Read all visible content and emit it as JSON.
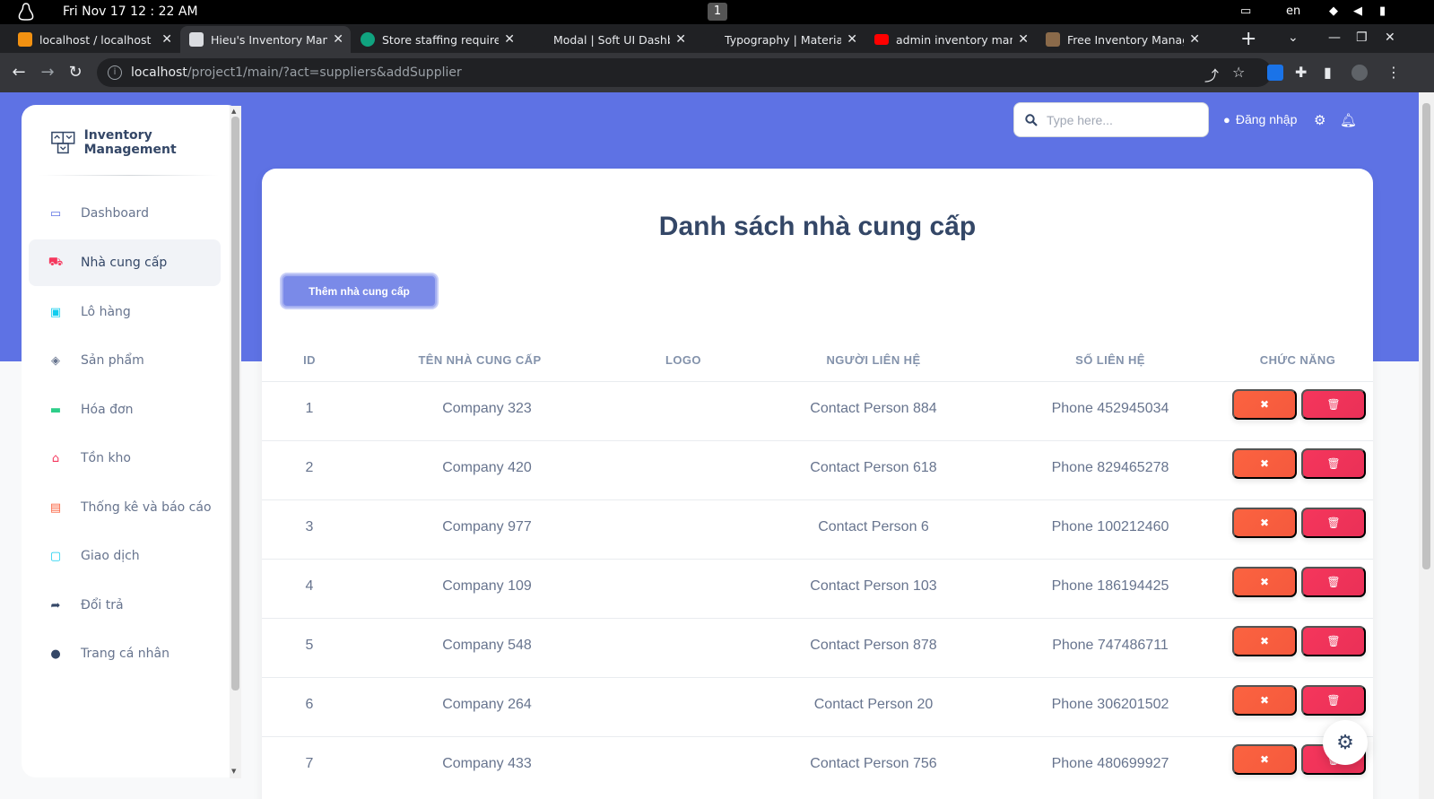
{
  "os": {
    "clock": "Fri Nov 17 12 : 22 AM",
    "workspace": "1",
    "lang": "en"
  },
  "browser": {
    "tabs": [
      {
        "title": "localhost / localhost",
        "fav_color": "#f29111",
        "active": false
      },
      {
        "title": "Hieu's Inventory Mana",
        "fav_color": "#dadce0",
        "active": true
      },
      {
        "title": "Store staffing require",
        "fav_color": "#10a37f",
        "active": false
      },
      {
        "title": "Modal | Soft UI Dashb",
        "fav_color": "#202124",
        "active": false
      },
      {
        "title": "Typography | Materia",
        "fav_color": "#202124",
        "active": false
      },
      {
        "title": "admin inventory mana",
        "fav_color": "#ff0000",
        "active": false
      },
      {
        "title": "Free Inventory Manag",
        "fav_color": "#8a6a4a",
        "active": false
      }
    ],
    "url_host": "localhost",
    "url_path": "/project1/main/?act=suppliers&addSupplier"
  },
  "sidebar": {
    "brand": "Inventory Management",
    "items": [
      {
        "label": "Dashboard",
        "icon": "monitor-icon",
        "color": "#5e72e4",
        "active": false
      },
      {
        "label": "Nhà cung cấp",
        "icon": "truck-icon",
        "color": "#f5365c",
        "active": true
      },
      {
        "label": "Lô hàng",
        "icon": "box-icon",
        "color": "#11cdef",
        "active": false
      },
      {
        "label": "Sản phẩm",
        "icon": "cube-icon",
        "color": "#67748e",
        "active": false
      },
      {
        "label": "Hóa đơn",
        "icon": "credit-card-icon",
        "color": "#2dce89",
        "active": false
      },
      {
        "label": "Tồn kho",
        "icon": "shop-icon",
        "color": "#f5365c",
        "active": false
      },
      {
        "label": "Thống kê và báo cáo",
        "icon": "report-icon",
        "color": "#fb6340",
        "active": false
      },
      {
        "label": "Giao dịch",
        "icon": "receipt-icon",
        "color": "#11cdef",
        "active": false
      },
      {
        "label": "Đổi trả",
        "icon": "share-arrow-icon",
        "color": "#344767",
        "active": false
      },
      {
        "label": "Trang cá nhân",
        "icon": "user-icon",
        "color": "#344767",
        "active": false
      }
    ]
  },
  "navbar": {
    "search_placeholder": "Type here...",
    "login_label": "Đăng nhập"
  },
  "main": {
    "title": "Danh sách nhà cung cấp",
    "add_button": "Thêm nhà cung cấp",
    "columns": [
      "ID",
      "TÊN NHÀ CUNG CẤP",
      "LOGO",
      "NGƯỜI LIÊN HỆ",
      "SỐ LIÊN HỆ",
      "CHỨC NĂNG"
    ],
    "rows": [
      {
        "id": "1",
        "name": "Company 323",
        "contact": "Contact Person 884",
        "phone": "Phone 452945034"
      },
      {
        "id": "2",
        "name": "Company 420",
        "contact": "Contact Person 618",
        "phone": "Phone 829465278"
      },
      {
        "id": "3",
        "name": "Company 977",
        "contact": "Contact Person 6",
        "phone": "Phone 100212460"
      },
      {
        "id": "4",
        "name": "Company 109",
        "contact": "Contact Person 103",
        "phone": "Phone 186194425"
      },
      {
        "id": "5",
        "name": "Company 548",
        "contact": "Contact Person 878",
        "phone": "Phone 747486711"
      },
      {
        "id": "6",
        "name": "Company 264",
        "contact": "Contact Person 20",
        "phone": "Phone 306201502"
      },
      {
        "id": "7",
        "name": "Company 433",
        "contact": "Contact Person 756",
        "phone": "Phone 480699927"
      }
    ]
  },
  "colors": {
    "primary": "#5e72e4",
    "edit": "#fb6340",
    "delete": "#f5365c",
    "heading": "#344767"
  }
}
